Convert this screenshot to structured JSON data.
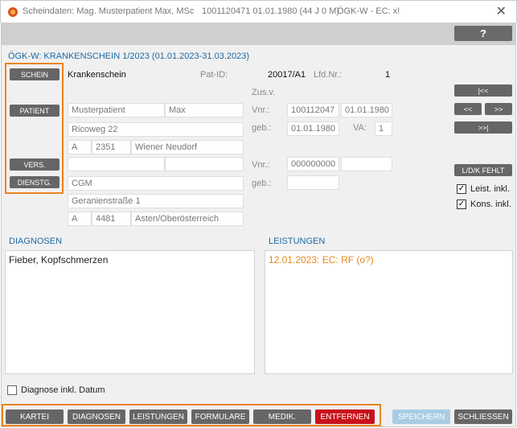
{
  "window": {
    "title_left": "Scheindaten: Mag. Musterpatient Max, MSc",
    "title_mid": "1001120471 01.01.1980 (44 J 0 M)",
    "title_right": "ÖGK-W - EC: x!",
    "close_glyph": "✕"
  },
  "toolbar": {
    "help_label": "?"
  },
  "header": {
    "title": "ÖGK-W: KRANKENSCHEIN 1/2023 (01.01.2023-31.03.2023)"
  },
  "sidebar": {
    "schein_label": "SCHEIN",
    "patient_label": "PATIENT",
    "vers_label": "VERS.",
    "dienstg_label": "DIENSTG."
  },
  "schein": {
    "type": "Krankenschein",
    "patid_label": "Pat-ID:",
    "patid_value": "20017/A1",
    "lfdnr_label": "Lfd.Nr.:",
    "lfdnr_value": "1",
    "zusv_label": "Zus.v."
  },
  "patient": {
    "lastname": "Musterpatient",
    "firstname": "Max",
    "street": "Ricoweg 22",
    "country": "A",
    "zip": "2351",
    "city": "Wiener Neudorf",
    "vnr_label": "Vnr.:",
    "vnr": "100112047",
    "vnr_date": "01.01.1980",
    "geb_label": "geb.:",
    "geb": "01.01.1980",
    "va_label": "VA:",
    "va": "1"
  },
  "insured": {
    "lastname": "",
    "firstname": "",
    "vnr_label": "Vnr.:",
    "vnr": "000000000",
    "vnr_date": "",
    "geb_label": "geb.:",
    "geb": ""
  },
  "employer": {
    "name": "CGM",
    "street": "Geranienstraße 1",
    "country": "A",
    "zip": "4481",
    "city": "Asten/Oberösterreich"
  },
  "nav": {
    "first_label": "|<<",
    "prev_label": "<<",
    "next_label": ">>",
    "last_label": ">>|"
  },
  "options": {
    "ldk_label": "L/D/K FEHLT",
    "leist_label": "Leist. inkl.",
    "kons_label": "Kons. inkl."
  },
  "diagnosen": {
    "title": "DIAGNOSEN",
    "text": "Fieber, Kopfschmerzen",
    "inkl_datum_label": "Diagnose inkl. Datum"
  },
  "leistungen": {
    "title": "LEISTUNGEN",
    "entry": "12.01.2023: EC: RF (o?)",
    "entry_color": "#e8861a"
  },
  "footer": {
    "kartei": "KARTEI",
    "diagnosen": "DIAGNOSEN",
    "leistungen": "LEISTUNGEN",
    "formulare": "FORMULARE",
    "medik": "MEDIK.",
    "entfernen": "ENTFERNEN",
    "speichern": "SPEICHERN",
    "schliessen": "SCHLIESSEN"
  },
  "colors": {
    "accent_blue": "#1b6aa3",
    "highlight_orange": "#e98523",
    "danger_red": "#c8121c",
    "button_gray": "#666666"
  }
}
